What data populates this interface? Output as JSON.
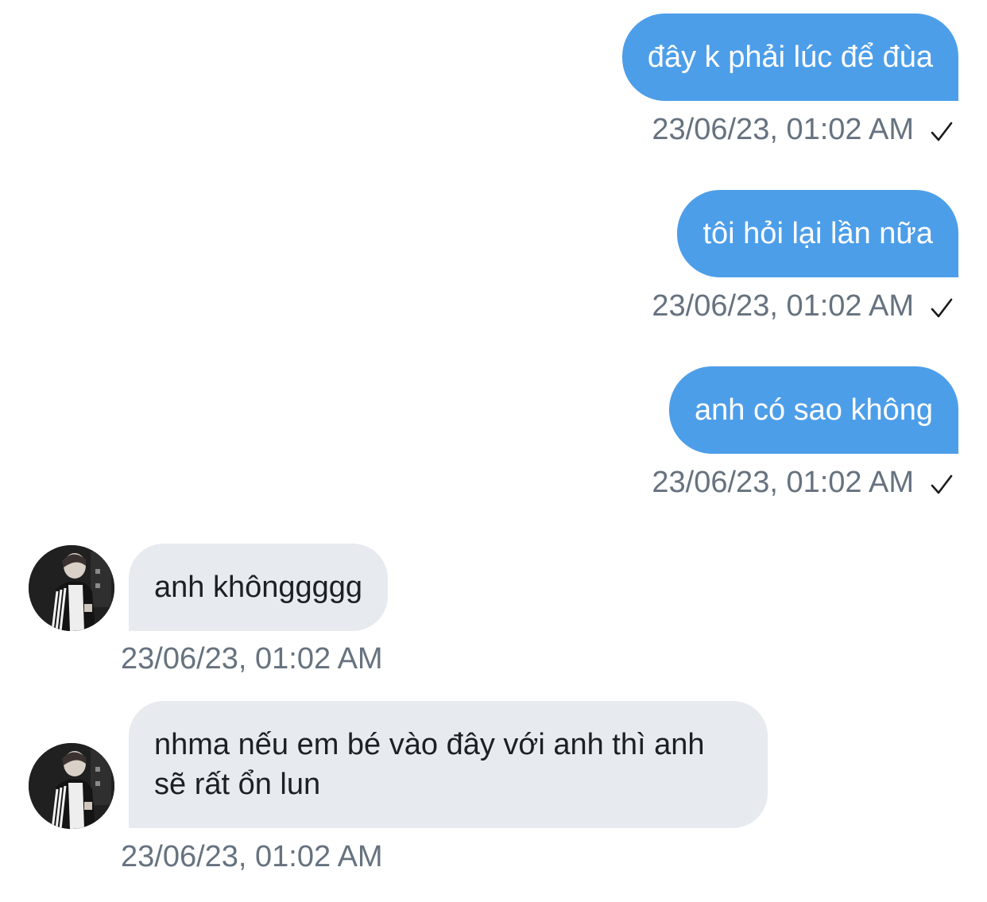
{
  "conversation": {
    "messages": [
      {
        "direction": "outgoing",
        "text": "đây k phải lúc để đùa",
        "timestamp": "23/06/23, 01:02 AM",
        "status_icon": "checkmark-icon"
      },
      {
        "direction": "outgoing",
        "text": "tôi hỏi lại lần nữa",
        "timestamp": "23/06/23, 01:02 AM",
        "status_icon": "checkmark-icon"
      },
      {
        "direction": "outgoing",
        "text": "anh có sao không",
        "timestamp": "23/06/23, 01:02 AM",
        "status_icon": "checkmark-icon"
      },
      {
        "direction": "incoming",
        "text": "anh khônggggg",
        "timestamp": "23/06/23, 01:02 AM",
        "avatar": "avatar-image"
      },
      {
        "direction": "incoming",
        "text": "nhma nếu em bé vào đây với anh thì anh sẽ rất ổn lun",
        "timestamp": "23/06/23, 01:02 AM",
        "avatar": "avatar-image"
      }
    ]
  },
  "colors": {
    "outgoing_bubble": "#4d9ee9",
    "incoming_bubble": "#e7eaef",
    "timestamp_text": "#66727f",
    "background": "#ffffff"
  }
}
